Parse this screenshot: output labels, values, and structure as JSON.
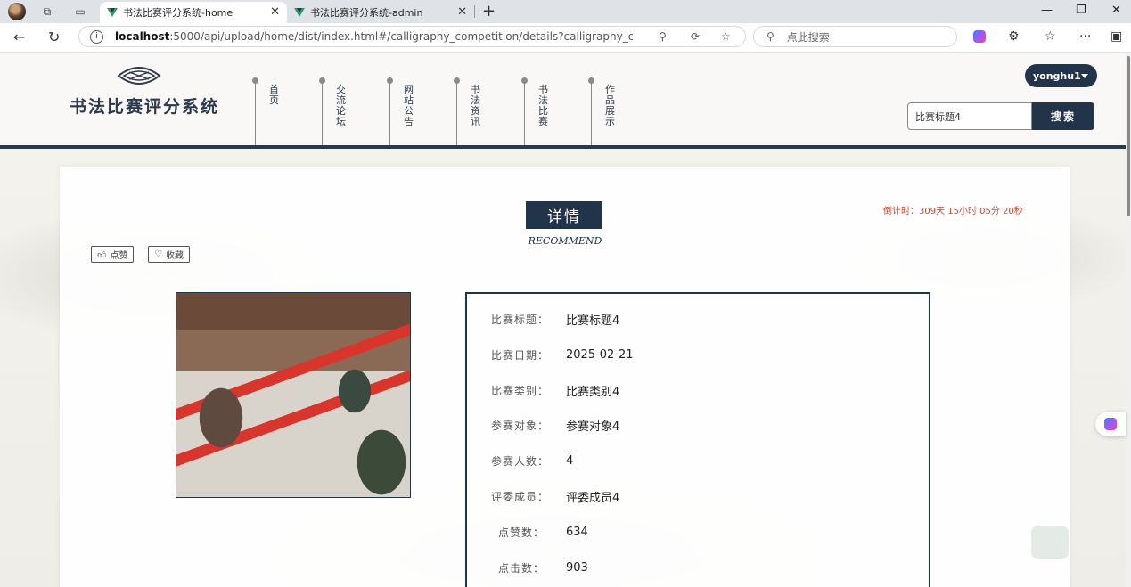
{
  "browser": {
    "tabs": [
      {
        "title": "书法比赛评分系统-home",
        "active": true
      },
      {
        "title": "书法比赛评分系统-admin",
        "active": false
      }
    ],
    "url_host": "localhost",
    "url_path": ":5000/api/upload/home/dist/index.html#/calligraphy_competition/details?calligraphy_competition_i...",
    "search_placeholder": "点此搜索"
  },
  "site": {
    "title": "书法比赛评分系统",
    "nav": [
      "首页",
      "交流论坛",
      "网站公告",
      "书法资讯",
      "书法比赛",
      "作品展示"
    ],
    "user": "yonghu1",
    "search_value": "比赛标题4",
    "search_button": "搜索"
  },
  "detail": {
    "badge": "详情",
    "subtitle": "RECOMMEND",
    "countdown": "倒计时：309天  15小时  05分  20秒",
    "like_label": "点赞",
    "collect_label": "收藏",
    "fields": [
      {
        "label": "比赛标题：",
        "value": "比赛标题4"
      },
      {
        "label": "比赛日期：",
        "value": "2025-02-21"
      },
      {
        "label": "比赛类别：",
        "value": "比赛类别4"
      },
      {
        "label": "参赛对象：",
        "value": "参赛对象4"
      },
      {
        "label": "参赛人数：",
        "value": "4"
      },
      {
        "label": "评委成员：",
        "value": "评委成员4"
      },
      {
        "label": "点赞数：",
        "value": "634"
      },
      {
        "label": "点击数：",
        "value": "903"
      }
    ]
  },
  "colors": {
    "primary": "#22344a",
    "countdown": "#e0432b"
  }
}
